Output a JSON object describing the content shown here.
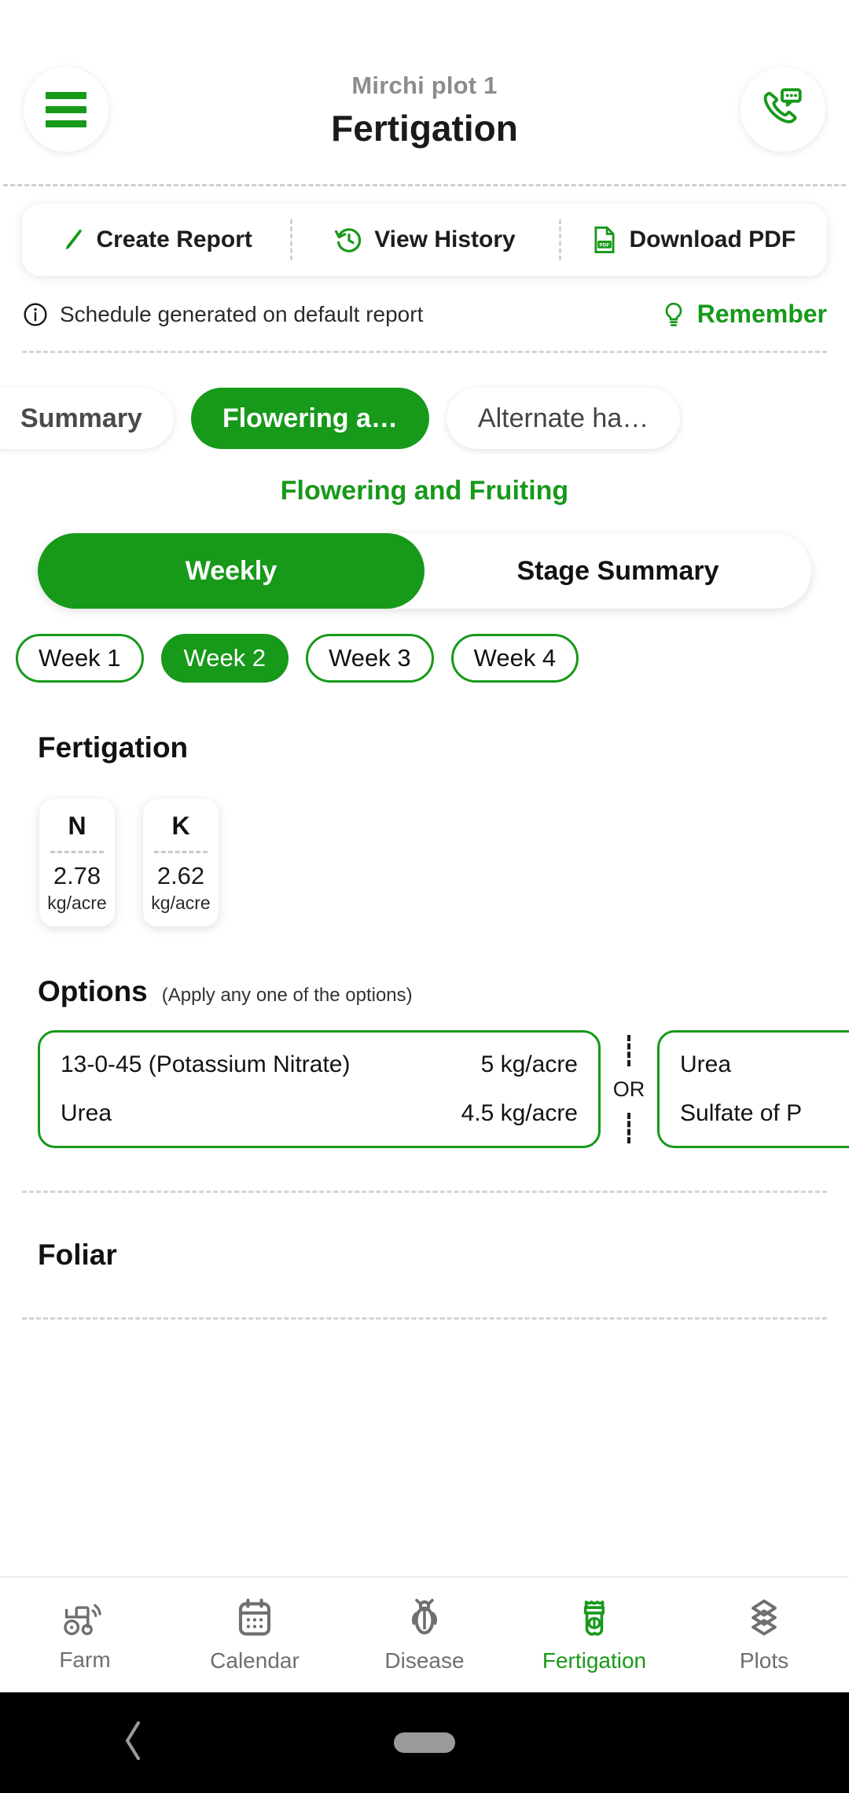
{
  "header": {
    "subtitle": "Mirchi plot 1",
    "title": "Fertigation",
    "menu_icon": "hamburger-menu-icon",
    "support_icon": "phone-chat-support-icon"
  },
  "actionbar": {
    "items": [
      {
        "label": "Create Report",
        "icon": "pencil-edit-icon"
      },
      {
        "label": "View History",
        "icon": "history-clock-icon"
      },
      {
        "label": "Download PDF",
        "icon": "pdf-file-icon"
      }
    ]
  },
  "note": {
    "icon": "info-circle-icon",
    "text": "Schedule generated on default report",
    "remember_icon": "lightbulb-icon",
    "remember_label": "Remember"
  },
  "crop_tabs": {
    "items": [
      {
        "label": "Summary",
        "state": "plain"
      },
      {
        "label": "Flowering a…",
        "state": "active"
      },
      {
        "label": "Alternate ha…",
        "state": "idle"
      }
    ]
  },
  "stage": {
    "title": "Flowering and Fruiting"
  },
  "view_toggle": {
    "options": [
      {
        "label": "Weekly",
        "selected": true
      },
      {
        "label": "Stage Summary",
        "selected": false
      }
    ]
  },
  "weeks": {
    "items": [
      {
        "label": "Week 1",
        "selected": false
      },
      {
        "label": "Week 2",
        "selected": true
      },
      {
        "label": "Week 3",
        "selected": false
      },
      {
        "label": "Week 4",
        "selected": false
      }
    ]
  },
  "fertigation": {
    "section_title": "Fertigation",
    "nutrients": [
      {
        "symbol": "N",
        "value": "2.78",
        "unit": "kg/acre"
      },
      {
        "symbol": "K",
        "value": "2.62",
        "unit": "kg/acre"
      }
    ]
  },
  "options": {
    "title": "Options",
    "subtitle": "(Apply any one of the options)",
    "separator_label": "OR",
    "cards": [
      {
        "lines": [
          {
            "name": "13-0-45 (Potassium Nitrate)",
            "qty": "5 kg/acre"
          },
          {
            "name": "Urea",
            "qty": "4.5 kg/acre"
          }
        ]
      },
      {
        "lines": [
          {
            "name": "Urea",
            "qty": ""
          },
          {
            "name": "Sulfate of P",
            "qty": ""
          }
        ]
      }
    ]
  },
  "foliar": {
    "section_title": "Foliar"
  },
  "bottom_nav": {
    "items": [
      {
        "label": "Farm",
        "icon": "tractor-icon",
        "active": false
      },
      {
        "label": "Calendar",
        "icon": "calendar-icon",
        "active": false
      },
      {
        "label": "Disease",
        "icon": "bug-icon",
        "active": false
      },
      {
        "label": "Fertigation",
        "icon": "fertilizer-bag-icon",
        "active": true
      },
      {
        "label": "Plots",
        "icon": "layers-icon",
        "active": false
      }
    ]
  },
  "system_bar": {
    "back_icon": "back-chevron-icon",
    "home_icon": "home-pill-icon"
  },
  "colors": {
    "brand_green": "#17991a",
    "muted_text": "#8c8c8c",
    "dark_text": "#1a1a1a"
  }
}
